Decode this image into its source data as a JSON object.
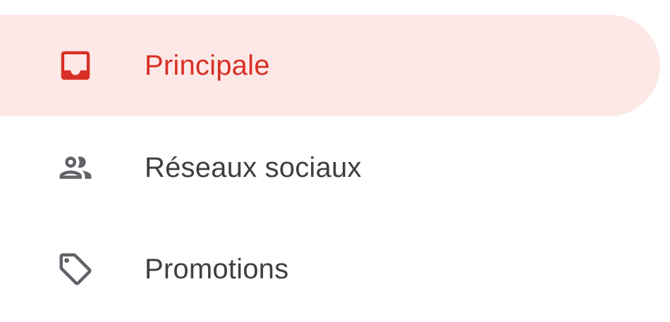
{
  "colors": {
    "selected_bg": "#fce8e6",
    "selected_fg": "#d93025",
    "default_fg": "#3c4043",
    "icon_default": "#5f6368"
  },
  "nav": {
    "items": [
      {
        "label": "Principale",
        "icon": "inbox-icon",
        "selected": true
      },
      {
        "label": "Réseaux sociaux",
        "icon": "people-icon",
        "selected": false
      },
      {
        "label": "Promotions",
        "icon": "tag-icon",
        "selected": false
      }
    ]
  }
}
